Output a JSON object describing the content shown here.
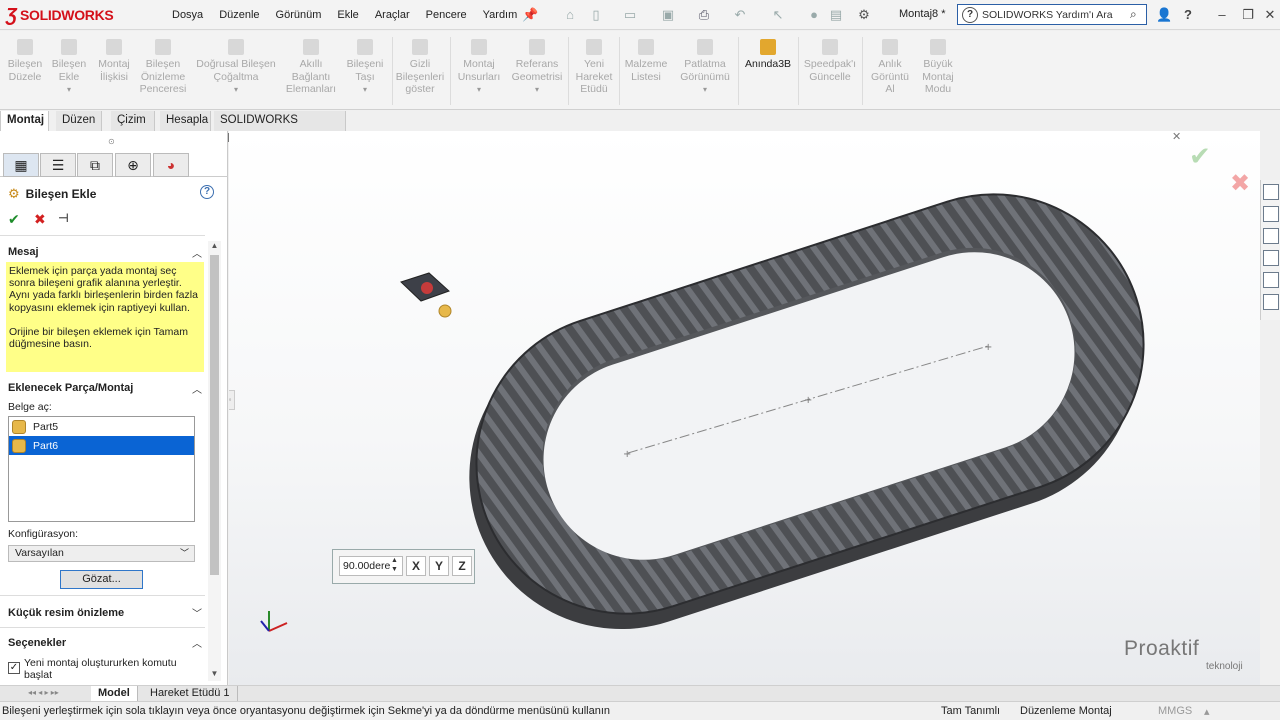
{
  "titlebar": {
    "brand": "SOLIDWORKS",
    "menu": [
      "Dosya",
      "Düzenle",
      "Görünüm",
      "Ekle",
      "Araçlar",
      "Pencere",
      "Yardım"
    ],
    "document_title": "Montaj8 *",
    "search_placeholder": "SOLIDWORKS Yardım'ı Ara"
  },
  "command_manager": {
    "items": [
      {
        "label": "Bileşen\nDüzele",
        "active": false
      },
      {
        "label": "Bileşen\nEkle",
        "active": false
      },
      {
        "label": "Montaj\nİlişkisi",
        "active": false
      },
      {
        "label": "Bileşen\nÖnizleme\nPenceresi",
        "active": false
      },
      {
        "label": "Doğrusal Bileşen\nÇoğaltma",
        "active": false
      },
      {
        "label": "Akıllı\nBağlantı\nElemanları",
        "active": false
      },
      {
        "label": "Bileşeni\nTaşı",
        "active": false
      },
      {
        "label": "Gizli\nBileşenleri\ngöster",
        "active": false
      },
      {
        "label": "Montaj\nUnsurları",
        "active": false
      },
      {
        "label": "Referans\nGeometrisi",
        "active": false
      },
      {
        "label": "Yeni\nHareket\nEtüdü",
        "active": false
      },
      {
        "label": "Malzeme\nListesi",
        "active": false
      },
      {
        "label": "Patlatma\nGörünümü",
        "active": false
      },
      {
        "label": "Anında3B",
        "active": true
      },
      {
        "label": "Speedpak'ı\nGüncelle",
        "active": false
      },
      {
        "label": "Anlık\nGörüntü\nAl",
        "active": false
      },
      {
        "label": "Büyük\nMontaj\nModu",
        "active": false
      }
    ]
  },
  "tabs": [
    "Montaj",
    "Düzen",
    "Çizim",
    "Hesapla",
    "SOLIDWORKS Eklentileri"
  ],
  "panel": {
    "title": "Bileşen Ekle",
    "sections": {
      "message_header": "Mesaj",
      "message_p1": "Eklemek için parça yada montaj seç sonra bileşeni grafik alanına yerleştir. Aynı yada farklı birleşenlerin birden fazla kopyasını eklemek için raptiyeyi kullan.",
      "message_p2": "Orijine bir bileşen eklemek için Tamam düğmesine basın.",
      "parts_header": "Eklenecek Parça/Montaj",
      "open_docs_label": "Belge aç:",
      "parts": [
        "Part5",
        "Part6"
      ],
      "config_label": "Konfigürasyon:",
      "config_value": "Varsayılan",
      "browse_button": "Gözat...",
      "thumbnail_header": "Küçük resim önizleme",
      "options_header": "Seçenekler",
      "option_start_cmd": "Yeni montaj oluştururken komutu başlat",
      "option_start_cmd_checked": true
    }
  },
  "graphics": {
    "angle_value": "90.00dere"
  },
  "bottom_tabs": [
    "Model",
    "Hareket Etüdü 1"
  ],
  "statusbar": {
    "hint": "Bileşeni yerleştirmek için sola tıklayın veya önce oryantasyonu değiştirmek için Sekme'yi ya da döndürme menüsünü kullanın",
    "state": "Tam Tanımlı",
    "mode": "Düzenleme Montaj",
    "units": "MMGS"
  },
  "watermark": {
    "name": "Proaktif",
    "sub": "teknoloji"
  }
}
